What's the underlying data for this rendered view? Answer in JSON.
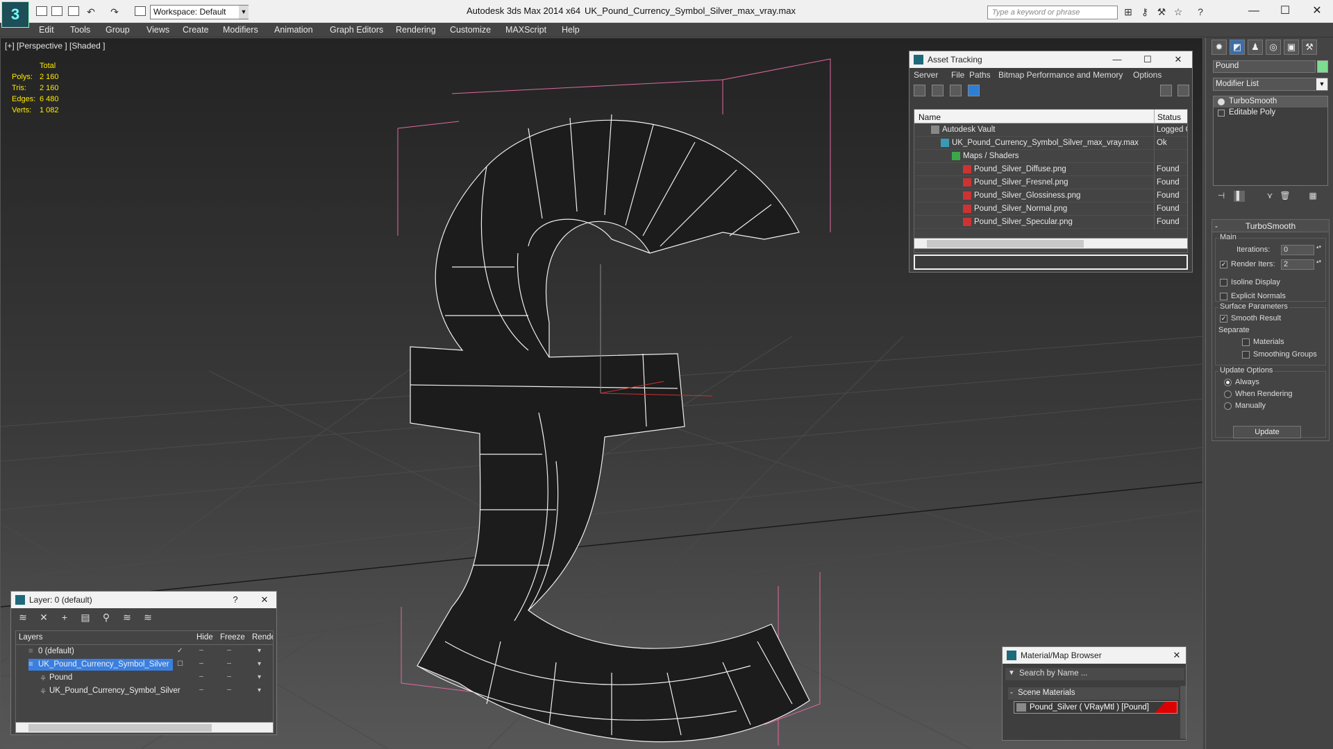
{
  "titlebar": {
    "workspace": "Workspace: Default",
    "app_title": "Autodesk 3ds Max  2014 x64",
    "file_title": "UK_Pound_Currency_Symbol_Silver_max_vray.max",
    "search_placeholder": "Type a keyword or phrase"
  },
  "menu": [
    "Edit",
    "Tools",
    "Group",
    "Views",
    "Create",
    "Modifiers",
    "Animation",
    "Graph Editors",
    "Rendering",
    "Customize",
    "MAXScript",
    "Help"
  ],
  "viewport": {
    "label": "[+] [Perspective ] [Shaded ]",
    "stats": {
      "header": "Total",
      "rows": [
        {
          "key": "Polys:",
          "value": "2 160"
        },
        {
          "key": "Tris:",
          "value": "2 160"
        },
        {
          "key": "Edges:",
          "value": "6 480"
        },
        {
          "key": "Verts:",
          "value": "1 082"
        }
      ]
    }
  },
  "asset_tracking": {
    "title": "Asset Tracking",
    "menu": [
      "Server",
      "File",
      "Paths",
      "Bitmap Performance and Memory",
      "Options"
    ],
    "col_name": "Name",
    "col_status": "Status",
    "rows": [
      {
        "name": "Autodesk Vault",
        "status": "Logged O"
      },
      {
        "name": "UK_Pound_Currency_Symbol_Silver_max_vray.max",
        "status": "Ok"
      },
      {
        "name": "Maps / Shaders",
        "status": ""
      },
      {
        "name": "Pound_Silver_Diffuse.png",
        "status": "Found"
      },
      {
        "name": "Pound_Silver_Fresnel.png",
        "status": "Found"
      },
      {
        "name": "Pound_Silver_Glossiness.png",
        "status": "Found"
      },
      {
        "name": "Pound_Silver_Normal.png",
        "status": "Found"
      },
      {
        "name": "Pound_Silver_Specular.png",
        "status": "Found"
      }
    ]
  },
  "command_panel": {
    "object_name": "Pound",
    "object_color": "#7cdc90",
    "modifier_list": "Modifier List",
    "stack": [
      "TurboSmooth",
      "Editable Poly"
    ],
    "turbosmooth": {
      "title": "TurboSmooth",
      "main": "Main",
      "iterations_label": "Iterations:",
      "iterations": "0",
      "render_iters_label": "Render Iters:",
      "render_iters": "2",
      "isoline": "Isoline Display",
      "explicit_normals": "Explicit Normals",
      "surface_params": "Surface Parameters",
      "smooth_result": "Smooth Result",
      "separate": "Separate",
      "materials": "Materials",
      "smoothing_groups": "Smoothing Groups",
      "update_options": "Update Options",
      "always": "Always",
      "when_rendering": "When Rendering",
      "manually": "Manually",
      "update_button": "Update"
    }
  },
  "layer_panel": {
    "title": "Layer: 0 (default)",
    "col_layers": "Layers",
    "col_hide": "Hide",
    "col_freeze": "Freeze",
    "col_render": "Render",
    "rows": [
      {
        "name": "0 (default)"
      },
      {
        "name": "UK_Pound_Currency_Symbol_Silver"
      },
      {
        "name": "Pound"
      },
      {
        "name": "UK_Pound_Currency_Symbol_Silver"
      }
    ]
  },
  "material_browser": {
    "title": "Material/Map Browser",
    "search_placeholder": "Search by Name ...",
    "group": "Scene Materials",
    "item": "Pound_Silver  ( VRayMtl )  [Pound]"
  }
}
